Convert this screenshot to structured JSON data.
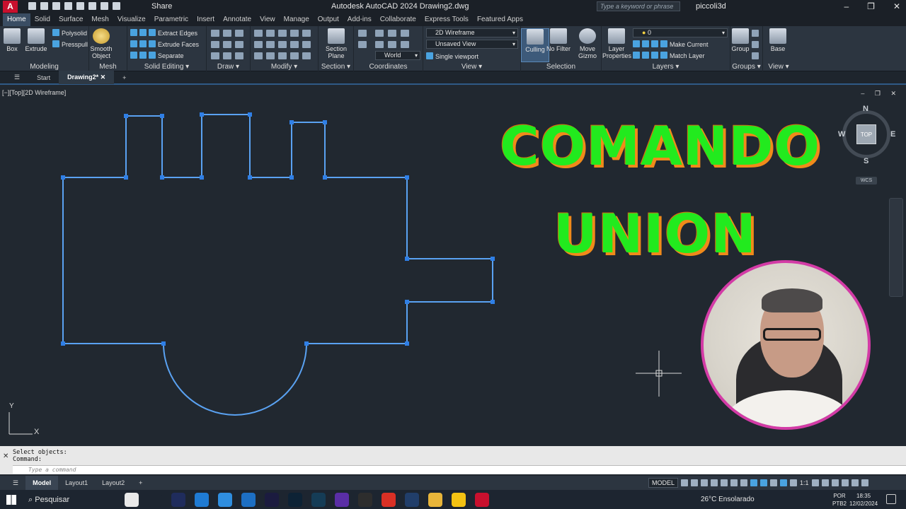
{
  "window": {
    "logo": "A",
    "share": "Share",
    "title": "Autodesk AutoCAD 2024    Drawing2.dwg",
    "search_placeholder": "Type a keyword or phrase",
    "user": "piccoli3d",
    "min": "–",
    "max": "❐",
    "close": "✕"
  },
  "ribbon_tabs": [
    "Home",
    "Solid",
    "Surface",
    "Mesh",
    "Visualize",
    "Parametric",
    "Insert",
    "Annotate",
    "View",
    "Manage",
    "Output",
    "Add-ins",
    "Collaborate",
    "Express Tools",
    "Featured Apps"
  ],
  "ribbon": {
    "modeling": {
      "title": "Modeling",
      "box": "Box",
      "extrude": "Extrude",
      "polysolid": "Polysolid",
      "presspull": "Presspull"
    },
    "mesh": {
      "title": "Mesh",
      "smooth": "Smooth Object"
    },
    "solid_editing": {
      "title": "Solid Editing ▾",
      "extract_edges": "Extract Edges",
      "extrude_faces": "Extrude Faces",
      "separate": "Separate"
    },
    "draw": {
      "title": "Draw ▾"
    },
    "modify": {
      "title": "Modify ▾"
    },
    "section": {
      "title": "Section ▾",
      "plane": "Section Plane"
    },
    "coordinates": {
      "title": "Coordinates",
      "world": "World"
    },
    "view": {
      "title": "View ▾",
      "visual_style": "2D Wireframe",
      "saved_view": "Unsaved View",
      "viewport": "Single viewport"
    },
    "selection": {
      "title": "Selection",
      "culling": "Culling",
      "no_filter": "No Filter",
      "move_gizmo": "Move Gizmo"
    },
    "layers": {
      "title": "Layers ▾",
      "layer_props": "Layer Properties",
      "current_layer": "0",
      "make_current": "Make Current",
      "match_layer": "Match Layer"
    },
    "groups": {
      "title": "Groups ▾",
      "group": "Group"
    },
    "view2": {
      "title": "View ▾",
      "base": "Base"
    }
  },
  "file_tabs": {
    "start": "Start",
    "drawing": "Drawing2*",
    "new": "+"
  },
  "viewport": {
    "label": "[−][Top][2D Wireframe]",
    "controls": "– ❐ ✕",
    "overlay_line1": "COMANDO",
    "overlay_line2": "UNION",
    "ucs_x": "X",
    "ucs_y": "Y"
  },
  "viewcube": {
    "n": "N",
    "s": "S",
    "e": "E",
    "w": "W",
    "top": "TOP",
    "wcs": "WCS"
  },
  "command": {
    "history1": "Select objects:",
    "history2": "Command:",
    "placeholder": "Type a command"
  },
  "layout_tabs": [
    "Model",
    "Layout1",
    "Layout2",
    "+"
  ],
  "status": {
    "model": "MODEL",
    "scale": "1:1"
  },
  "taskbar": {
    "search": "Pesquisar",
    "weather": "26°C  Ensolarado",
    "lang1": "POR",
    "lang2": "PTB2",
    "time": "18:35",
    "date": "12/02/2024"
  },
  "taskbar_apps": [
    {
      "name": "copilot",
      "color": "#e9e9e9"
    },
    {
      "name": "task-view",
      "color": "#1d2530"
    },
    {
      "name": "media-encoder",
      "color": "#1f2c5c"
    },
    {
      "name": "edge",
      "color": "#1f7bd4"
    },
    {
      "name": "store",
      "color": "#2f8ee0"
    },
    {
      "name": "mail",
      "color": "#1d6fc4"
    },
    {
      "name": "after-effects",
      "color": "#1b1b3f"
    },
    {
      "name": "photoshop",
      "color": "#0d2235"
    },
    {
      "name": "react-app",
      "color": "#153c56"
    },
    {
      "name": "vegas",
      "color": "#5a2ea6"
    },
    {
      "name": "obs",
      "color": "#2d2d2d"
    },
    {
      "name": "chrome",
      "color": "#d93025"
    },
    {
      "name": "cinema4d",
      "color": "#213e6a"
    },
    {
      "name": "folder",
      "color": "#e8b53a"
    },
    {
      "name": "powerpoint-like",
      "color": "#f3c213"
    },
    {
      "name": "autocad",
      "color": "#c8102e"
    }
  ]
}
